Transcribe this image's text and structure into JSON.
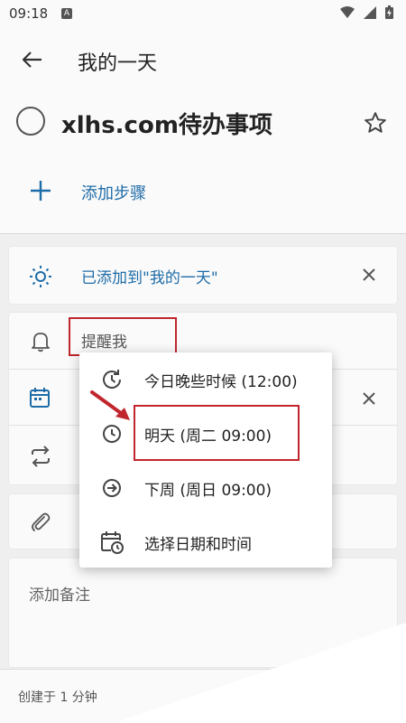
{
  "status_bar": {
    "time": "09:18",
    "app_badge": "A"
  },
  "header": {
    "title": "我的一天"
  },
  "task": {
    "title": "xlhs.com待办事项"
  },
  "add_step": {
    "label": "添加步骤"
  },
  "my_day": {
    "label": "已添加到\"我的一天\""
  },
  "reminder": {
    "label": "提醒我"
  },
  "menu": {
    "items": [
      {
        "label": "今日晚些时候 (12:00)",
        "icon": "later-today-icon"
      },
      {
        "label": "明天 (周二 09:00)",
        "icon": "clock-icon"
      },
      {
        "label": "下周 (周日 09:00)",
        "icon": "arrow-circle-icon"
      },
      {
        "label": "选择日期和时间",
        "icon": "calendar-clock-icon"
      }
    ]
  },
  "note": {
    "placeholder": "添加备注"
  },
  "footer": {
    "text": "创建于 1 分钟"
  },
  "colors": {
    "accent": "#1e6ca8",
    "highlight": "#c0262d"
  }
}
